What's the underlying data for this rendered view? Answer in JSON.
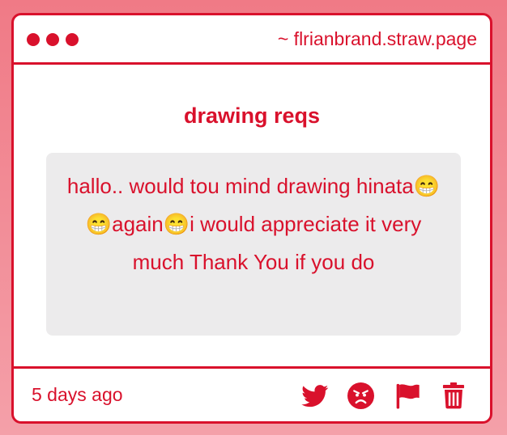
{
  "window": {
    "url": "~ flrianbrand.straw.page"
  },
  "post": {
    "title": "drawing reqs",
    "message": "hallo.. would tou mind drawing hinata😁😁again😁i would appreciate it very much Thank You if you do",
    "timestamp": "5 days ago"
  },
  "footer": {
    "actions": [
      {
        "icon": "twitter-icon"
      },
      {
        "icon": "angry-face-icon"
      },
      {
        "icon": "flag-icon"
      },
      {
        "icon": "trash-icon"
      }
    ]
  },
  "colors": {
    "accent": "#d9112c",
    "background_top": "#f07a86",
    "background_bottom": "#f4a0a9",
    "bubble": "#ecebec",
    "card": "#ffffff"
  }
}
